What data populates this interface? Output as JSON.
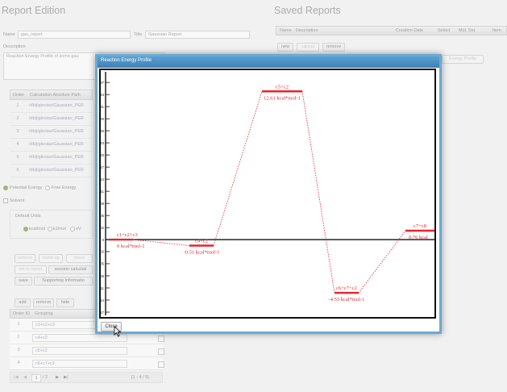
{
  "report": {
    "title": "Report Edition",
    "name_label": "Name",
    "name_value": "gau_report",
    "title_label": "Title",
    "title_value": "Gaussian Report",
    "description_label": "Description",
    "description_value": "Reaction Energy Profile of some gau",
    "calc_table": {
      "col_order": "Order",
      "col_path": "Calculation Absolute Path",
      "rows": [
        {
          "order": "1",
          "path": "/db/jiglesias/Gaussian_PER"
        },
        {
          "order": "2",
          "path": "/db/jiglesias/Gaussian_PER"
        },
        {
          "order": "3",
          "path": "/db/jiglesias/Gaussian_PER"
        },
        {
          "order": "4",
          "path": "/db/jiglesias/Gaussian_PER"
        },
        {
          "order": "5",
          "path": "/db/jiglesias/Gaussian_PER"
        },
        {
          "order": "6",
          "path": "/db/jiglesias/Gaussian_PER"
        }
      ]
    },
    "energy_potential": "Potential Energy",
    "energy_free": "Free Energy",
    "solvent": "Solvent",
    "default_units_label": "Default Units",
    "unit_kcal": "kcal/mol",
    "unit_kj": "kJ/mol",
    "unit_ev": "eV",
    "toolbar_row1": [
      "remove",
      "move up",
      "move"
    ],
    "toolbar_row2": [
      "set to report",
      "session calculati"
    ],
    "toolbar_row3": [
      "save",
      "Supporting Informatio"
    ],
    "group_toolbar": [
      "add",
      "remove",
      "hide"
    ],
    "group_col_order": "Order ID",
    "group_col_grouping": "Grouping",
    "groupings": [
      {
        "id": "1",
        "name": "c1+c2+c3"
      },
      {
        "id": "2",
        "name": "c4+c2"
      },
      {
        "id": "3",
        "name": "c5+c2"
      },
      {
        "id": "4",
        "name": "c6+c7+c2"
      }
    ],
    "pager": {
      "first": "|◀",
      "prev": "◀",
      "page": "1",
      "of": "/ 2",
      "next": "▶",
      "last": "▶|",
      "range": "[1 - 4 / 5]"
    }
  },
  "saved": {
    "title": "Saved Reports",
    "col_name": "Name",
    "col_description": "Description",
    "col_creation": "Creation Date",
    "col_select": "Select",
    "col_mol": "Mol. Sel.",
    "col_item": "Item",
    "btn_new": "new",
    "btn_cancel": "cancel",
    "btn_remove": "remove",
    "btn_profile": "Energy Profile"
  },
  "modal": {
    "title": "Reaction Energy Profile",
    "close_label": "Close"
  },
  "chart_data": {
    "type": "line",
    "title": "",
    "xlabel": "",
    "ylabel": "",
    "ylim": [
      -6.17,
      14.0
    ],
    "yticks": [
      "13.37",
      "12.34",
      "11.31",
      "10.28",
      "9.26",
      "8.23",
      "7.20",
      "6.17",
      "5.14",
      "4.11",
      "3.08",
      "2.05",
      "1.02",
      "0",
      "-1.02",
      "-2.05",
      "-3.08",
      "-4.11",
      "-5.14",
      "-6.17"
    ],
    "yticks_drawn": [
      13.37,
      12.34,
      11.31,
      10.28,
      9.26,
      8.23,
      7.2,
      6.17,
      5.14,
      4.11,
      3.08,
      2.05,
      1.02,
      0,
      -1.02,
      -2.05,
      -3.08,
      -4.11,
      -5.14,
      -6.17
    ],
    "colors": {
      "series": "#e8242c",
      "axis": "#111111"
    },
    "levels": [
      {
        "name": "c1+c2+c3",
        "energy": 0,
        "label": "0 kcal*mol-1"
      },
      {
        "name": "c4+c2",
        "energy": -0.51,
        "label": "-0.51 kcal*mol-1"
      },
      {
        "name": "c5+c2",
        "energy": 12.61,
        "label": "12.61 kcal*mol-1"
      },
      {
        "name": "c6+c7+c2",
        "energy": -4.53,
        "label": "-4.53 kcal*mol-1"
      },
      {
        "name": "c7+c8",
        "energy": 0.76,
        "label": "0.76 kcal"
      }
    ]
  }
}
